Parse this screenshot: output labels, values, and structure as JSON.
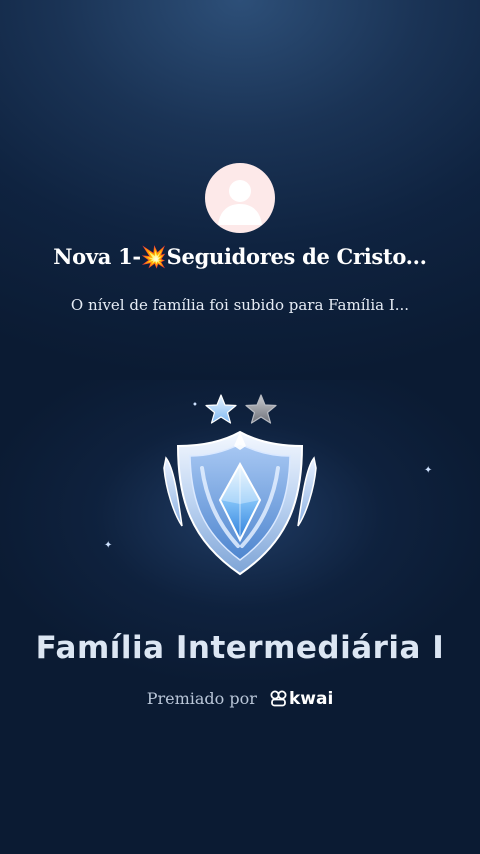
{
  "group": {
    "name": "Nova 1-💥Seguidores de Cristo...",
    "notice": "O nível de família foi subido para Família I..."
  },
  "level": {
    "name": "Família Intermediária I",
    "stars_total": 2,
    "stars_lit": 1
  },
  "award": {
    "label": "Premiado por",
    "brand": "kwai"
  },
  "icons": {
    "avatar": "default-user-avatar-icon",
    "badge": "shield-diamond-badge-icon",
    "star_lit": "star-icon",
    "star_unlit": "star-icon",
    "brand": "kwai-logo-icon"
  },
  "colors": {
    "background": "#0f2340",
    "avatar_bg": "#fde9e9",
    "star_lit": "#bfe0ff",
    "star_unlit": "#8c8f96",
    "badge_blue": "#5d9be6"
  }
}
